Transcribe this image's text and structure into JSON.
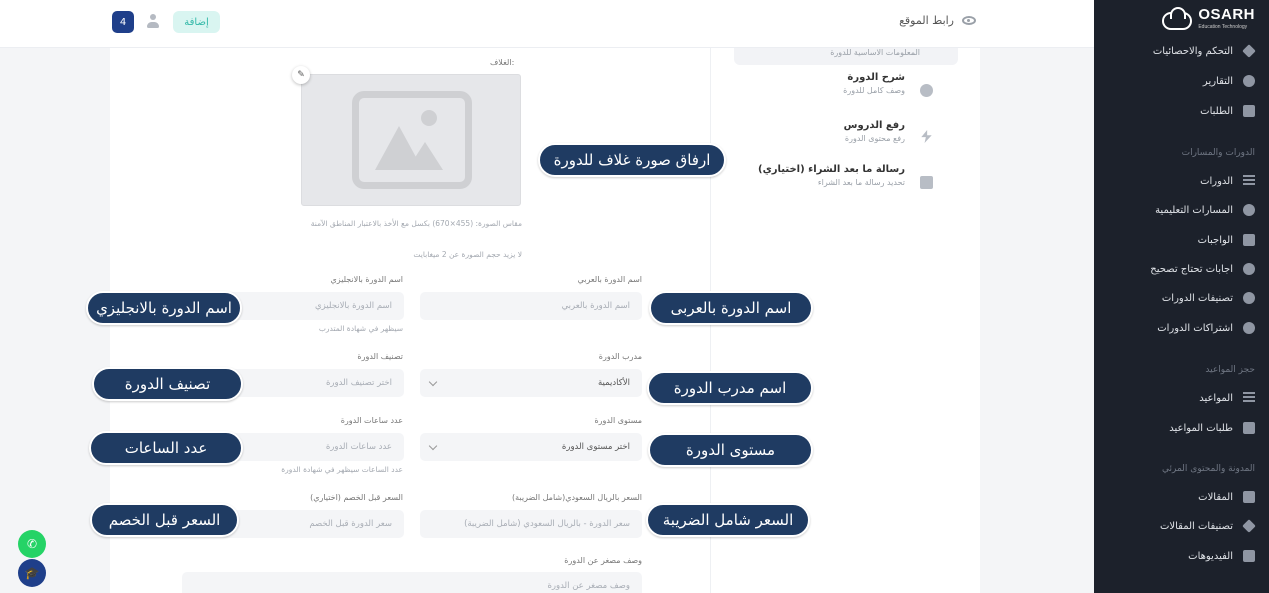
{
  "topbar": {
    "site_link": "رابط الموقع",
    "notif_count": "4",
    "add_button": "إضافة"
  },
  "sidebar": {
    "logo_name": "OSARH",
    "logo_sub": "Education Technology",
    "items_top": [
      {
        "label": "التحكم والاحصائيات",
        "icon": "dashboard-icon"
      },
      {
        "label": "التقارير",
        "icon": "pie-chart-icon"
      },
      {
        "label": "الطلبات",
        "icon": "basket-icon"
      }
    ],
    "section_courses": "الدورات والمسارات",
    "items_courses": [
      {
        "label": "الدورات",
        "icon": "list-icon"
      },
      {
        "label": "المسارات التعليمية",
        "icon": "path-icon"
      },
      {
        "label": "الواجبات",
        "icon": "check-icon"
      },
      {
        "label": "اجابات تحتاج تصحيح",
        "icon": "question-icon"
      },
      {
        "label": "تصنيفات الدورات",
        "icon": "eye-icon"
      },
      {
        "label": "اشتراكات الدورات",
        "icon": "user-icon"
      }
    ],
    "section_appointments": "حجز المواعيد",
    "items_appointments": [
      {
        "label": "المواعيد",
        "icon": "list-icon"
      },
      {
        "label": "طلبات المواعيد",
        "icon": "basket-icon"
      }
    ],
    "section_blog": "المدونة والمحتوى المرئي",
    "items_blog": [
      {
        "label": "المقالات",
        "icon": "document-icon"
      },
      {
        "label": "تصنيفات المقالات",
        "icon": "tag-icon"
      },
      {
        "label": "الفيديوهات",
        "icon": "video-icon"
      }
    ]
  },
  "steps": {
    "top_partial": "المعلومات الاساسية للدورة",
    "items": [
      {
        "title": "شرح الدورة",
        "desc": "وصف كامل للدورة"
      },
      {
        "title": "رفع الدروس",
        "desc": "رفع محتوى الدورة"
      },
      {
        "title": "رسالة ما بعد الشراء (اختياري)",
        "desc": "تحديد رسالة ما بعد الشراء"
      }
    ]
  },
  "form": {
    "cover_label": "الغلاف:",
    "cover_hint_1": "مقاس الصورة: (455×670) بكسل مع الأخذ بالاعتبار المناطق الآمنة",
    "cover_hint_2": "لا يزيد حجم الصورة عن 2 ميغابايت",
    "name_ar_label": "اسم الدورة بالعربي",
    "name_ar_placeholder": "اسم الدورة بالعربي",
    "name_en_label": "اسم الدورة بالانجليزي",
    "name_en_placeholder": "اسم الدورة بالانجليزي",
    "name_en_hint": "سيظهر في شهادة المتدرب",
    "trainer_label": "مدرب الدورة",
    "trainer_value": "الأكاديمية",
    "category_label": "تصنيف الدورة",
    "category_placeholder": "اختر تصنيف الدورة",
    "level_label": "مستوى الدورة",
    "level_placeholder": "اختر مستوى الدورة",
    "hours_label": "عدد ساعات الدورة",
    "hours_placeholder": "عدد ساعات الدورة",
    "hours_hint": "عدد الساعات سيظهر في شهادة الدورة",
    "price_label": "السعر بالريال السعودي(شامل الضريبة)",
    "price_placeholder": "سعر الدورة - بالريال السعودي (شامل الضريبة)",
    "old_price_label": "السعر قبل الخصم (اختياري)",
    "old_price_placeholder": "سعر الدورة قبل الخصم",
    "short_desc_label": "وصف مصغر عن الدورة",
    "short_desc_placeholder": "وصف مصغر عن الدورة"
  },
  "annotations": {
    "cover": "ارفاق صورة غلاف للدورة",
    "name_en": "اسم الدورة بالانجليزي",
    "name_ar": "اسم الدورة بالعربى",
    "category": "تصنيف الدورة",
    "trainer": "اسم مدرب الدورة",
    "hours": "عدد الساعات",
    "level": "مستوى الدورة",
    "old_price": "السعر قبل الخصم",
    "price": "السعر شامل الضريبة"
  }
}
